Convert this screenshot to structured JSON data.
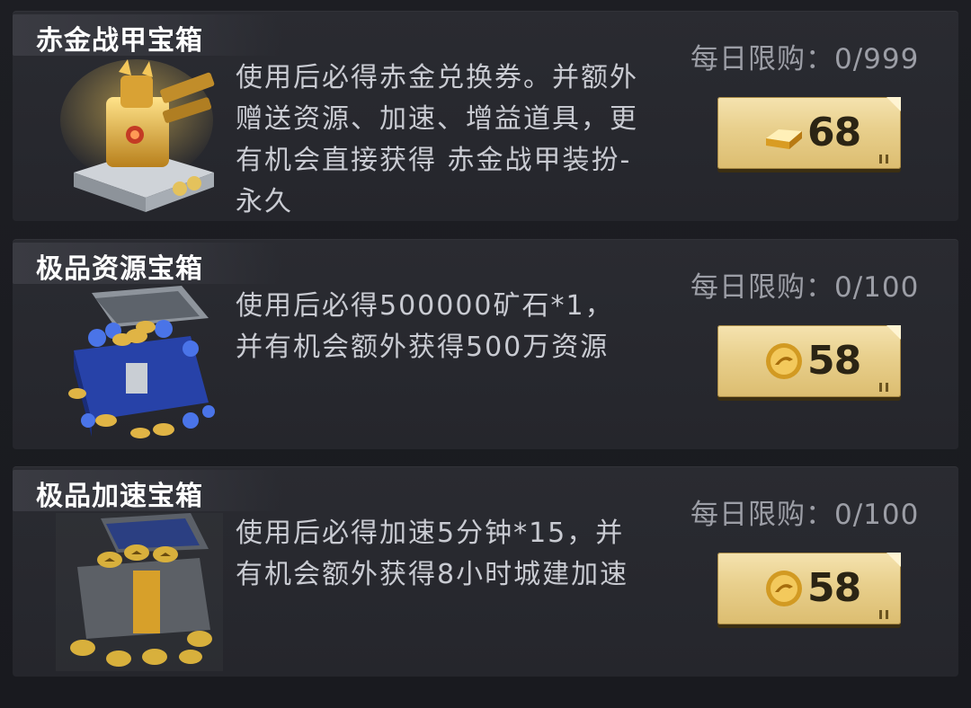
{
  "items": [
    {
      "title": "赤金战甲宝箱",
      "image": "gold-armor-chest-icon",
      "description": "使用后必得赤金兑换券。并额外赠送资源、加速、增益道具，更有机会直接获得 赤金战甲装扮-永久",
      "limit": "每日限购：0/999",
      "currency": "gold-bar-icon",
      "price": "68"
    },
    {
      "title": "极品资源宝箱",
      "image": "resource-chest-icon",
      "description": "使用后必得500000矿石*1，并有机会额外获得500万资源",
      "limit": "每日限购：0/100",
      "currency": "gold-coin-icon",
      "price": "58"
    },
    {
      "title": "极品加速宝箱",
      "image": "speedup-chest-icon",
      "description": "使用后必得加速5分钟*15，并有机会额外获得8小时城建加速",
      "limit": "每日限购：0/100",
      "currency": "gold-coin-icon",
      "price": "58"
    }
  ],
  "colors": {
    "background": "#1b1c21",
    "card": "#2a2b31",
    "button_gold": "#e8cf8c",
    "price_text": "#2b2414"
  }
}
